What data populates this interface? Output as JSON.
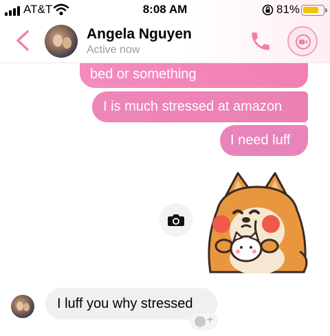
{
  "status_bar": {
    "carrier": "AT&T",
    "time": "8:08 AM",
    "battery_percent_text": "81%",
    "battery_level": 0.81,
    "icons": [
      "signal-bars-icon",
      "wifi-icon",
      "orientation-lock-icon",
      "battery-icon"
    ]
  },
  "header": {
    "contact_name": "Angela Nguyen",
    "contact_status": "Active now",
    "icons": [
      "back-chevron-icon",
      "phone-icon",
      "video-camera-icon"
    ]
  },
  "messages": {
    "outgoing": [
      {
        "text": "bed or something"
      },
      {
        "text": "I is much stressed at amazon"
      },
      {
        "text": "I need luff"
      }
    ],
    "sticker": {
      "name": "shiba-dog-hugging-cat-sticker"
    },
    "incoming": [
      {
        "text": "I luff you why stressed"
      }
    ]
  },
  "colors": {
    "accent_pink": "#f17fb4",
    "incoming_bubble": "#f0f0f0",
    "battery_yellow": "#f5c400"
  }
}
